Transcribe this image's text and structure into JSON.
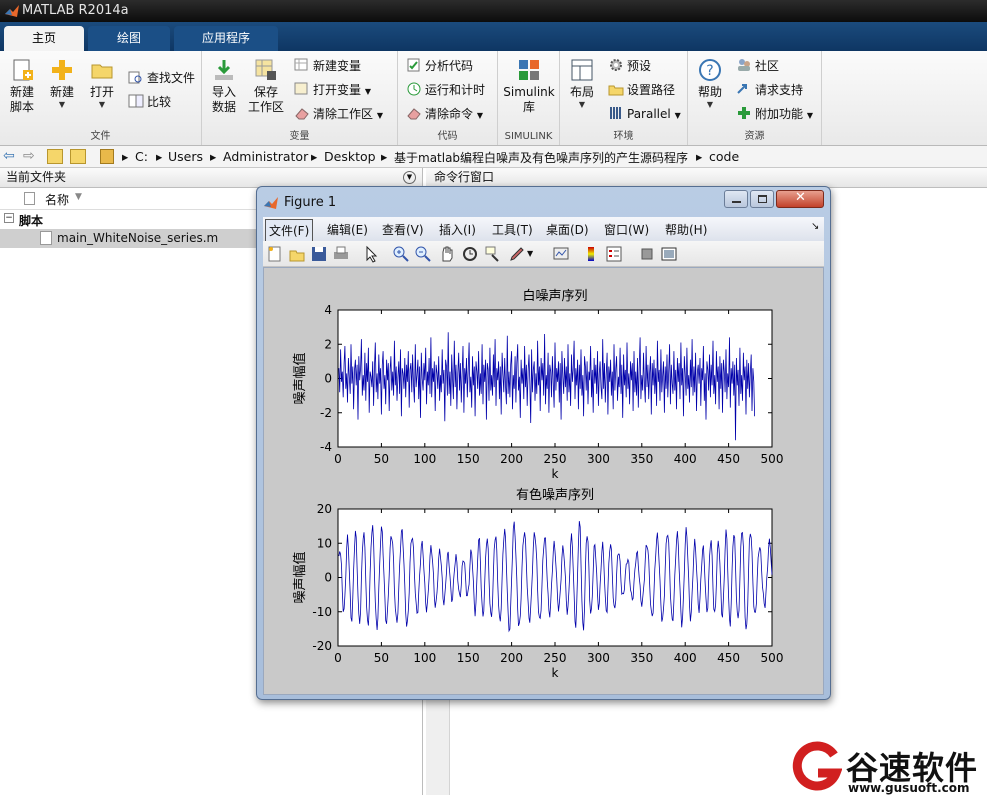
{
  "app": {
    "title": "MATLAB R2014a"
  },
  "tabs": [
    {
      "label": "主页"
    },
    {
      "label": "绘图"
    },
    {
      "label": "应用程序"
    }
  ],
  "ribbon": {
    "file": {
      "label": "文件",
      "new_script": "新建\n脚本",
      "new": "新建",
      "open": "打开",
      "find_files": "查找文件",
      "compare": "比较"
    },
    "variable": {
      "label": "变量",
      "import": "导入\n数据",
      "save_ws": "保存\n工作区",
      "new_var": "新建变量",
      "open_var": "打开变量",
      "clear_ws": "清除工作区"
    },
    "code": {
      "label": "代码",
      "analyze": "分析代码",
      "run_time": "运行和计时",
      "clear_cmd": "清除命令"
    },
    "simulink": {
      "label": "SIMULINK",
      "lib": "Simulink\n库"
    },
    "env": {
      "label": "环境",
      "layout": "布局",
      "prefs": "预设",
      "set_path": "设置路径",
      "parallel": "Parallel"
    },
    "res": {
      "label": "资源",
      "help": "帮助",
      "community": "社区",
      "support": "请求支持",
      "addons": "附加功能"
    }
  },
  "address": {
    "parts": [
      "C:",
      "Users",
      "Administrator",
      "Desktop",
      "基于matlab编程白噪声及有色噪声序列的产生源码程序",
      "code"
    ]
  },
  "left_pane": {
    "header": "当前文件夹",
    "col_name": "名称",
    "group": "脚本",
    "file": "main_WhiteNoise_series.m"
  },
  "right_pane": {
    "header": "命令行窗口"
  },
  "figure": {
    "title": "Figure 1",
    "menus": [
      "文件(F)",
      "编辑(E)",
      "查看(V)",
      "插入(I)",
      "工具(T)",
      "桌面(D)",
      "窗口(W)",
      "帮助(H)"
    ]
  },
  "chart_data": [
    {
      "type": "line",
      "title": "白噪声序列",
      "xlabel": "k",
      "ylabel": "噪声幅值",
      "xlim": [
        0,
        500
      ],
      "ylim": [
        -4,
        4
      ],
      "xticks": [
        0,
        50,
        100,
        150,
        200,
        250,
        300,
        350,
        400,
        450,
        500
      ],
      "yticks": [
        -4,
        -2,
        0,
        2,
        4
      ],
      "color": "#0000aa",
      "series": [
        {
          "x_range": [
            1,
            500
          ],
          "values": [
            0.6,
            -0.8,
            1.7,
            -0.2,
            0.4,
            -1.1,
            0.9,
            1.9,
            -0.6,
            0.3,
            -1.4,
            1.2,
            0.1,
            -0.9,
            2.0,
            -0.3,
            0.7,
            -1.8,
            0.5,
            1.1,
            -0.4,
            0.8,
            -2.4,
            1.3,
            -0.1,
            0.6,
            2.3,
            -1.0,
            0.2,
            -0.7,
            1.5,
            -1.3,
            0.9,
            -0.2,
            1.8,
            -2.0,
            0.4,
            0.1,
            -0.5,
            1.0,
            -1.6,
            0.7,
            2.1,
            -0.8,
            0.3,
            -1.2,
            1.4,
            -0.3,
            0.6,
            -2.1,
            0.8,
            1.6,
            -0.6,
            0.2,
            -1.5,
            1.1,
            -0.1,
            0.9,
            -1.9,
            0.5,
            1.3,
            -0.7,
            0.4,
            -1.0,
            2.2,
            -0.4,
            0.7,
            -1.3,
            0.1,
            1.0,
            -0.9,
            1.7,
            -2.2,
            0.6,
            0.3,
            -0.6,
            1.2,
            -1.1,
            0.8,
            -0.2,
            1.6,
            -1.7,
            0.5,
            0.9,
            -0.8,
            1.4,
            -0.3,
            -1.4,
            2.0,
            -0.5,
            0.2,
            1.1,
            -1.2,
            0.7,
            -2.3,
            1.5,
            0.0,
            -0.7,
            0.9,
            -0.1,
            1.8,
            -1.5,
            0.4,
            -0.4,
            1.2,
            -0.9,
            2.4,
            -1.1,
            0.6,
            -0.2,
            1.0,
            -1.9,
            0.8,
            0.3,
            -0.6,
            1.3,
            -1.3,
            0.2,
            -0.8,
            1.7,
            -0.3,
            0.5,
            -2.5,
            1.1,
            0.7,
            -1.0,
            2.7,
            -0.9,
            0.4,
            -1.6,
            1.4,
            -0.1,
            -1.2,
            2.2,
            -0.5,
            0.8,
            -1.8,
            0.3,
            1.5,
            -0.7,
            0.9,
            -1.4,
            0.2,
            1.9,
            -2.0,
            0.6,
            -0.3,
            1.2,
            -1.1,
            0.5,
            2.1,
            -0.8,
            0.1,
            -1.7,
            1.3,
            -0.4,
            0.7,
            -2.2,
            1.0,
            0.4,
            -0.6,
            1.6,
            -1.0,
            0.3,
            -0.9,
            2.0,
            -1.5,
            0.8,
            -0.2,
            1.1,
            -2.4,
            0.9,
            0.5,
            -1.3,
            1.8,
            -0.7,
            0.2,
            -1.0,
            1.4,
            -0.5,
            2.3,
            -1.6,
            0.6,
            -0.1,
            1.0,
            -1.2,
            0.7,
            -2.1,
            1.5,
            0.3,
            -0.8,
            1.2,
            -0.4,
            -1.5,
            2.5,
            -0.9,
            0.4,
            -1.1,
            0.8,
            1.6,
            -1.8,
            0.2,
            -0.6,
            1.3,
            -1.4,
            0.9,
            2.0,
            -0.7,
            0.1,
            -2.3,
            1.1,
            -0.3,
            0.6,
            -1.2,
            1.9,
            -0.5,
            0.8,
            -1.6,
            0.4,
            1.4,
            -0.2,
            -2.6,
            1.7,
            -0.8,
            0.5,
            1.0,
            -1.3,
            0.3,
            -0.9,
            2.2,
            -0.4,
            0.7,
            -1.9,
            1.2,
            -0.1,
            0.9,
            -1.0,
            2.6,
            -1.5,
            0.2,
            -0.6,
            1.5,
            -2.0,
            0.8,
            0.4,
            -1.1,
            1.3,
            -0.3,
            -1.7,
            2.1,
            -0.7,
            0.6,
            -0.2,
            1.0,
            -1.4,
            0.9,
            -2.4,
            1.6,
            0.1,
            -0.9,
            1.2,
            -0.5,
            0.7,
            -1.3,
            2.0,
            -0.8,
            0.3,
            -1.6,
            1.4,
            -0.2,
            0.5,
            2.2,
            -1.2,
            0.6,
            -0.4,
            1.1,
            -1.8,
            0.8,
            -0.6,
            1.7,
            -1.0,
            0.2,
            -2.2,
            1.3,
            0.7,
            -0.7,
            1.0,
            -1.5,
            0.4,
            -0.1,
            1.9,
            -1.1,
            0.5,
            -2.0,
            1.2,
            -0.3,
            0.8,
            -0.9,
            1.6,
            -1.6,
            0.3,
            1.0,
            -0.5,
            -1.2,
            2.3,
            -0.6,
            0.9,
            -1.4,
            0.2,
            1.5,
            -2.1,
            0.7,
            -0.2,
            1.1,
            -1.0,
            0.4,
            -1.8,
            2.0,
            -0.7,
            0.6,
            1.3,
            -1.3,
            0.1,
            -0.5,
            1.8,
            -0.9,
            0.8,
            -2.3,
            1.4,
            -0.4,
            0.5,
            -1.1,
            2.1,
            -0.6,
            0.3,
            -1.5,
            1.0,
            -0.1,
            0.9,
            -1.9,
            1.6,
            -0.8,
            0.4,
            -1.0,
            1.2,
            -1.7,
            0.6,
            2.4,
            -1.2,
            0.2,
            -0.7,
            1.5,
            -0.3,
            -1.4,
            1.9,
            -0.5,
            0.8,
            -1.2,
            0.3,
            1.3,
            -2.1,
            0.9,
            -0.4,
            1.1,
            -0.9,
            0.6,
            -1.6,
            2.2,
            -0.2,
            0.5,
            -1.3,
            1.7,
            -0.8,
            0.1,
            1.0,
            -2.0,
            0.7,
            -0.6,
            1.4,
            -1.1,
            0.4,
            2.0,
            -1.5,
            0.8,
            -0.3,
            -0.9,
            1.6,
            -0.7,
            0.5,
            -1.8,
            1.2,
            -0.2,
            0.9,
            -1.2,
            2.1,
            -0.4,
            0.6,
            -2.2,
            1.3,
            0.3,
            -1.0,
            1.8,
            -0.6,
            0.2,
            -1.4,
            1.1,
            -0.5,
            2.3,
            -1.0,
            0.7,
            -0.8,
            1.5,
            -1.9,
            0.4,
            0.8,
            -0.3,
            1.2,
            -1.6,
            0.6,
            -0.1,
            1.9,
            -1.3,
            0.3,
            -2.4,
            1.0,
            0.5,
            -0.7,
            1.4,
            -1.1,
            0.8,
            -0.4,
            2.2,
            -0.9,
            0.2,
            -1.5,
            1.6,
            -0.2,
            0.7,
            -1.8,
            1.3,
            -0.6,
            0.9,
            -2.0,
            1.1,
            0.4,
            -0.8,
            1.7,
            -1.2,
            0.3,
            -0.5,
            2.4,
            -1.7,
            0.6,
            -0.3,
            1.0,
            -1.0,
            0.8,
            -3.6,
            1.2,
            -0.4,
            0.5,
            -1.6,
            1.8,
            -0.9,
            0.2,
            -1.3,
            1.5,
            -0.1,
            0.7,
            -2.1,
            1.1,
            -0.6,
            0.9,
            -1.1,
            0.3,
            1.4,
            -1.9,
            0.6,
            -0.2,
            -2.2
          ]
        }
      ]
    },
    {
      "type": "line",
      "title": "有色噪声序列",
      "xlabel": "k",
      "ylabel": "噪声幅值",
      "xlim": [
        0,
        500
      ],
      "ylim": [
        -20,
        20
      ],
      "xticks": [
        0,
        50,
        100,
        150,
        200,
        250,
        300,
        350,
        400,
        450,
        500
      ],
      "yticks": [
        -20,
        -10,
        0,
        10,
        20
      ],
      "color": "#0000aa",
      "series": [
        {
          "x_range": [
            1,
            500
          ],
          "envelope_points": [
            [
              0,
              8
            ],
            [
              10,
              12
            ],
            [
              20,
              -14
            ],
            [
              30,
              14
            ],
            [
              40,
              16
            ],
            [
              50,
              -15
            ],
            [
              60,
              13
            ],
            [
              70,
              14
            ],
            [
              80,
              -15
            ],
            [
              90,
              11
            ],
            [
              100,
              10
            ],
            [
              110,
              -9
            ],
            [
              120,
              8
            ],
            [
              130,
              7
            ],
            [
              140,
              -6
            ],
            [
              150,
              6
            ],
            [
              160,
              12
            ],
            [
              170,
              -12
            ],
            [
              180,
              13
            ],
            [
              190,
              14
            ],
            [
              200,
              -17
            ],
            [
              210,
              15
            ],
            [
              220,
              13
            ],
            [
              230,
              -14
            ],
            [
              240,
              12
            ],
            [
              250,
              10
            ],
            [
              260,
              -9
            ],
            [
              270,
              13
            ],
            [
              280,
              -18
            ],
            [
              290,
              12
            ],
            [
              300,
              9
            ],
            [
              310,
              -11
            ],
            [
              320,
              10
            ],
            [
              330,
              5
            ],
            [
              340,
              -7
            ],
            [
              350,
              8
            ],
            [
              360,
              12
            ],
            [
              370,
              -13
            ],
            [
              380,
              14
            ],
            [
              390,
              13
            ],
            [
              400,
              -15
            ],
            [
              410,
              11
            ],
            [
              420,
              9
            ],
            [
              430,
              -12
            ],
            [
              440,
              11
            ],
            [
              450,
              -15
            ],
            [
              460,
              13
            ],
            [
              470,
              -17
            ],
            [
              480,
              12
            ],
            [
              490,
              8
            ],
            [
              500,
              -12
            ]
          ]
        }
      ]
    }
  ],
  "watermark": {
    "brand": "谷速软件",
    "url": "www.gusuoft.com"
  }
}
